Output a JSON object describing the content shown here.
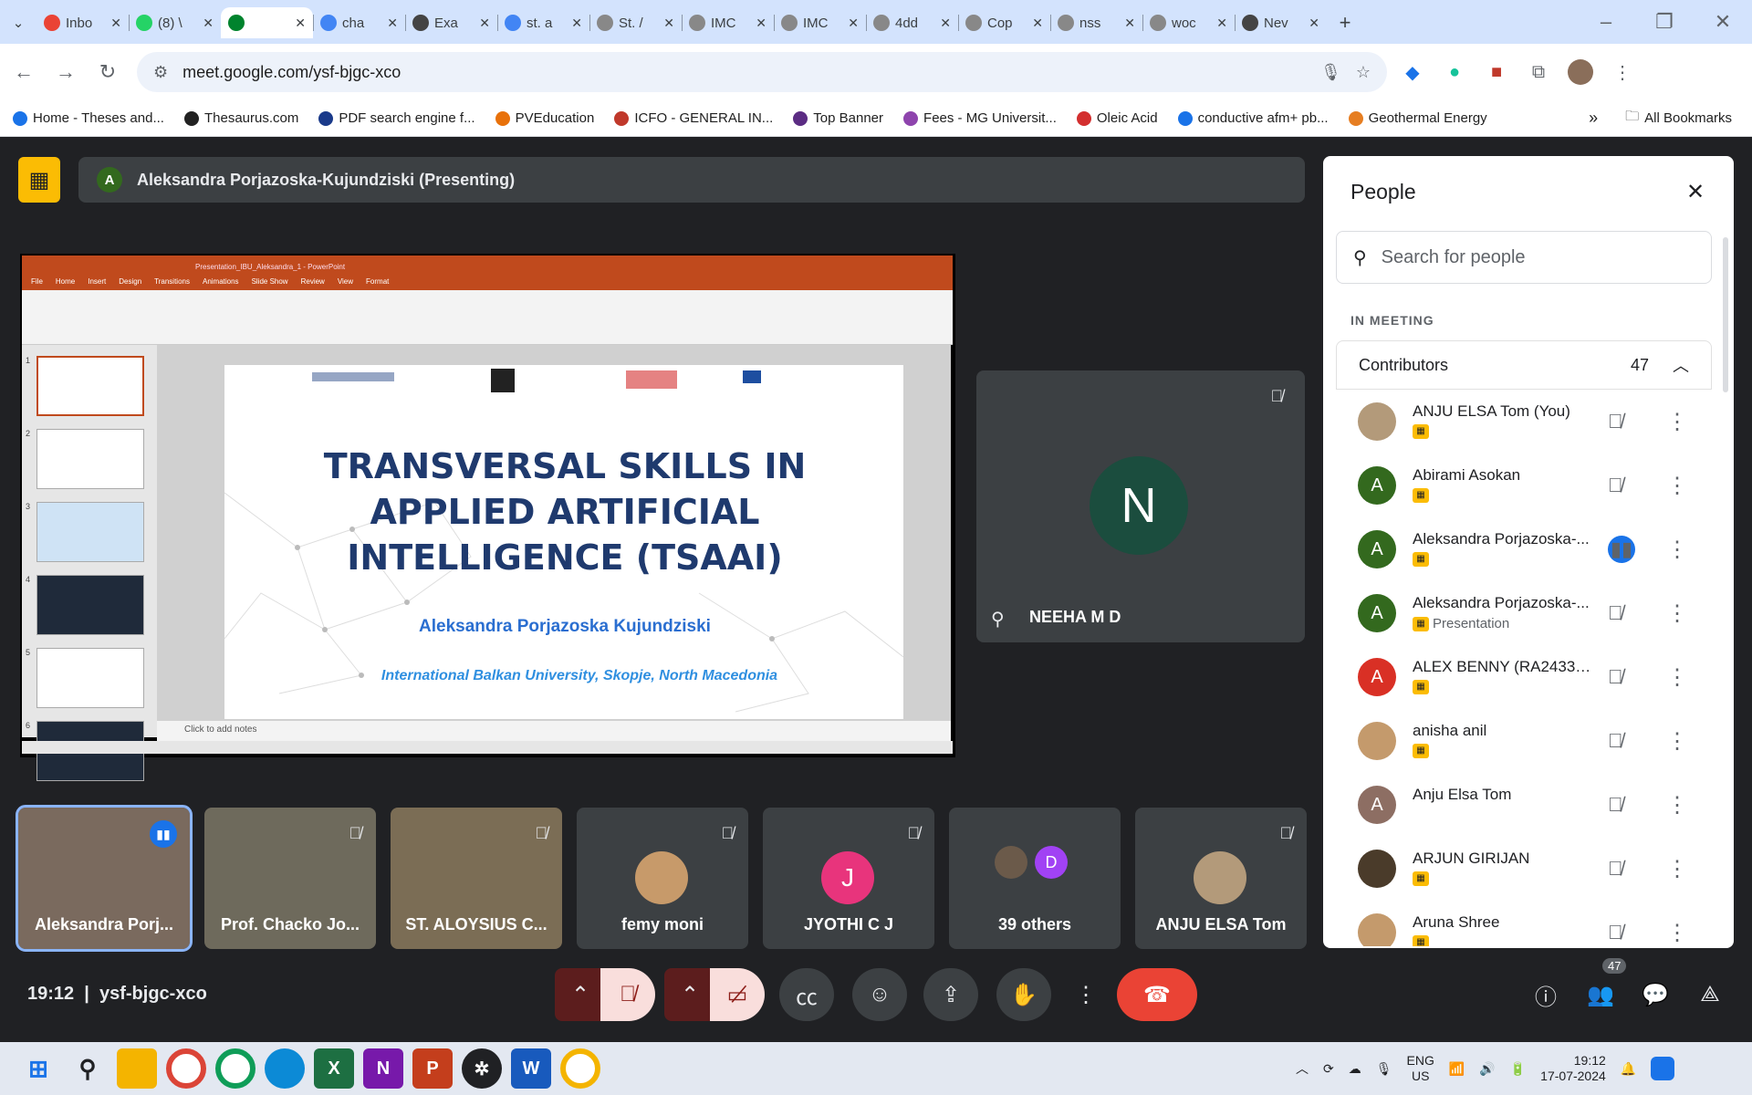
{
  "browser": {
    "tabs": [
      {
        "title": "Inbo",
        "color": "#ea4335"
      },
      {
        "title": "(8) \\",
        "color": "#25d366"
      },
      {
        "title": "",
        "color": "#00832d",
        "active": true
      },
      {
        "title": "cha",
        "color": "#4285f4"
      },
      {
        "title": "Exa",
        "color": "#444"
      },
      {
        "title": "st. a",
        "color": "#4285f4"
      },
      {
        "title": "St. /",
        "color": "#888"
      },
      {
        "title": "IMC",
        "color": "#888"
      },
      {
        "title": "IMC",
        "color": "#888"
      },
      {
        "title": "4dd",
        "color": "#888"
      },
      {
        "title": "Cop",
        "color": "#888"
      },
      {
        "title": "nss",
        "color": "#888"
      },
      {
        "title": "woc",
        "color": "#888"
      },
      {
        "title": "Nev",
        "color": "#444"
      }
    ],
    "new_tab": "+",
    "url": "meet.google.com/ysf-bjgc-xco",
    "bookmarks": [
      {
        "label": "Home - Theses and...",
        "color": "#1a73e8"
      },
      {
        "label": "Thesaurus.com",
        "color": "#222"
      },
      {
        "label": "PDF search engine f...",
        "color": "#1a3a8a"
      },
      {
        "label": "PVEducation",
        "color": "#e8710a"
      },
      {
        "label": "ICFO - GENERAL IN...",
        "color": "#c0392b"
      },
      {
        "label": "Top Banner",
        "color": "#5b2c83"
      },
      {
        "label": "Fees - MG Universit...",
        "color": "#8e44ad"
      },
      {
        "label": "Oleic Acid",
        "color": "#d32f2f"
      },
      {
        "label": "conductive afm+ pb...",
        "color": "#1a73e8"
      },
      {
        "label": "Geothermal Energy",
        "color": "#e67e22"
      }
    ],
    "all_bookmarks": "All Bookmarks"
  },
  "meet": {
    "presenter_initial": "A",
    "presenter_banner": "Aleksandra Porjazoska-Kujundziski (Presenting)",
    "slide": {
      "window_title": "Presentation_IBU_Aleksandra_1 - PowerPoint",
      "menu": [
        "File",
        "Home",
        "Insert",
        "Design",
        "Transitions",
        "Animations",
        "Slide Show",
        "Review",
        "View",
        "Format"
      ],
      "title": "TRANSVERSAL SKILLS IN APPLIED ARTIFICIAL INTELLIGENCE (TSAAI)",
      "author": "Aleksandra Porjazoska Kujundziski",
      "institution": "International Balkan University, Skopje, North Macedonia",
      "notes": "Click to add notes",
      "thumb_numbers": [
        "1",
        "2",
        "3",
        "4",
        "5",
        "6"
      ]
    },
    "tile_neeha": {
      "initial": "N",
      "name": "NEEHA M D"
    },
    "tiles": [
      {
        "name": "Aleksandra Porj...",
        "bg": "#7a6a5e"
      },
      {
        "name": "Prof. Chacko Jo...",
        "bg": "#6e6a5c"
      },
      {
        "name": "ST. ALOYSIUS C...",
        "bg": "#7b6d55"
      },
      {
        "name": "femy moni",
        "bg": "#3c4043",
        "initial": "",
        "avcolor": "#c79a6a"
      },
      {
        "name": "JYOTHI C J",
        "bg": "#3c4043",
        "initial": "J",
        "avcolor": "#e8347c"
      },
      {
        "name": "39 others",
        "bg": "#3c4043",
        "initial": "D",
        "avcolor": "#a142f4"
      },
      {
        "name": "ANJU ELSA Tom",
        "bg": "#3c4043",
        "initial": "",
        "avcolor": "#b39a7a"
      }
    ],
    "clock": "19:12",
    "meeting_code": "ysf-bjgc-xco",
    "participant_count": "47"
  },
  "people": {
    "title": "People",
    "search_placeholder": "Search for people",
    "section": "IN MEETING",
    "group": "Contributors",
    "group_count": "47",
    "list": [
      {
        "name": "ANJU ELSA Tom (You)",
        "initial": "",
        "color": "#b39a7a",
        "sub": ""
      },
      {
        "name": "Abirami Asokan",
        "initial": "A",
        "color": "#33691e",
        "sub": ""
      },
      {
        "name": "Aleksandra Porjazoska-...",
        "initial": "A",
        "color": "#33691e",
        "sub": "",
        "speaking": true
      },
      {
        "name": "Aleksandra Porjazoska-...",
        "initial": "A",
        "color": "#33691e",
        "sub": "Presentation"
      },
      {
        "name": "ALEX BENNY (RA243301...",
        "initial": "A",
        "color": "#d93025",
        "sub": ""
      },
      {
        "name": "anisha anil",
        "initial": "",
        "color": "#c49a6c",
        "sub": ""
      },
      {
        "name": "Anju Elsa Tom",
        "initial": "A",
        "color": "#8d6e63",
        "sub": ""
      },
      {
        "name": "ARJUN GIRIJAN",
        "initial": "",
        "color": "#4a3b2a",
        "sub": ""
      },
      {
        "name": "Aruna Shree",
        "initial": "",
        "color": "#c49a6c",
        "sub": ""
      }
    ]
  },
  "taskbar": {
    "lang": "ENG",
    "region": "US",
    "time": "19:12",
    "date": "17-07-2024"
  }
}
